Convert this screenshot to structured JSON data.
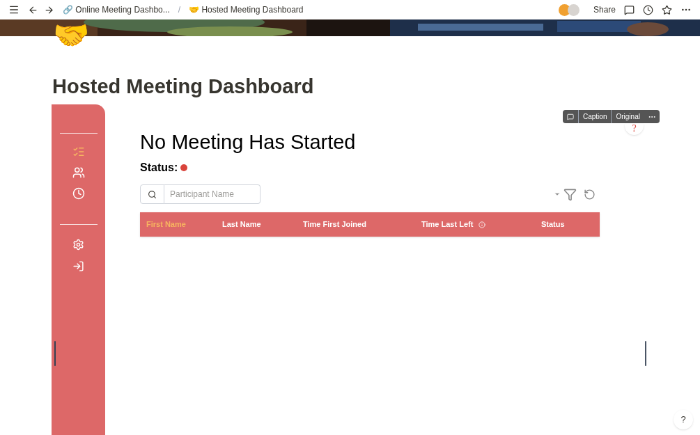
{
  "topbar": {
    "breadcrumbs": [
      {
        "icon": "🔗",
        "label": "Online Meeting Dashbo..."
      },
      {
        "icon": "🤝",
        "label": "Hosted Meeting Dashboard"
      }
    ],
    "separator": "/",
    "share": "Share"
  },
  "page": {
    "icon": "🤝",
    "title": "Hosted Meeting Dashboard"
  },
  "embed_toolbar": {
    "buttons": [
      "Caption",
      "Original"
    ]
  },
  "help_marker": "?",
  "sidebar": {
    "items": [
      {
        "kind": "list",
        "selected": true
      },
      {
        "kind": "people",
        "selected": false
      },
      {
        "kind": "clock",
        "selected": false
      }
    ],
    "bottom_items": [
      {
        "kind": "settings"
      },
      {
        "kind": "logout"
      }
    ]
  },
  "dashboard": {
    "heading": "No Meeting Has Started",
    "status": {
      "label": "Status:",
      "color": "#d9443b"
    },
    "search": {
      "placeholder": "Participant Name"
    },
    "columns": [
      {
        "label": "First Name",
        "selected": true,
        "info": false
      },
      {
        "label": "Last Name",
        "selected": false,
        "info": false
      },
      {
        "label": "Time First Joined",
        "selected": false,
        "info": false
      },
      {
        "label": "Time Last Left",
        "selected": false,
        "info": true
      },
      {
        "label": "Status",
        "selected": false,
        "info": false
      }
    ]
  },
  "help_button": "?"
}
